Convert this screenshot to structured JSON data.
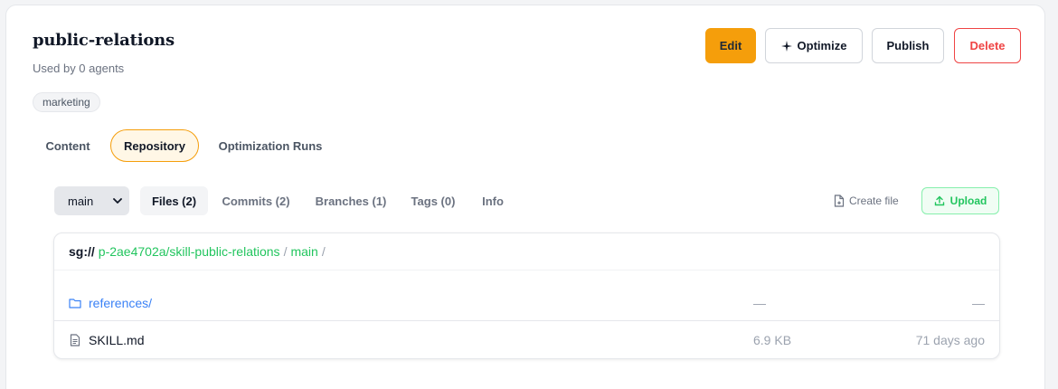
{
  "skill": {
    "title": "public-relations",
    "usage": "Used by 0 agents",
    "tag": "marketing"
  },
  "actions": {
    "edit": "Edit",
    "optimize": "Optimize",
    "publish": "Publish",
    "delete": "Delete"
  },
  "tabs": {
    "content": "Content",
    "repository": "Repository",
    "runs": "Optimization Runs",
    "active": "Repository"
  },
  "repo": {
    "branch": "main",
    "subtabs": {
      "files": "Files (2)",
      "commits": "Commits (2)",
      "branches": "Branches (1)",
      "tags": "Tags (0)",
      "info": "Info"
    },
    "create_file": "Create file",
    "upload": "Upload",
    "path": {
      "prefix": "sg://",
      "repo": "p-2ae4702a/skill-public-relations",
      "sep1": "/",
      "branch": "main",
      "sep2": "/"
    },
    "files": [
      {
        "name": "references/",
        "size": "—",
        "date": "—",
        "type": "folder-icon"
      },
      {
        "name": "SKILL.md",
        "size": "6.9 KB",
        "date": "71 days ago",
        "type": "file-icon"
      }
    ]
  },
  "colors": {
    "accent": "#f59e0b",
    "success": "#22c55e",
    "danger": "#ef4444",
    "link": "#3b82f6"
  }
}
